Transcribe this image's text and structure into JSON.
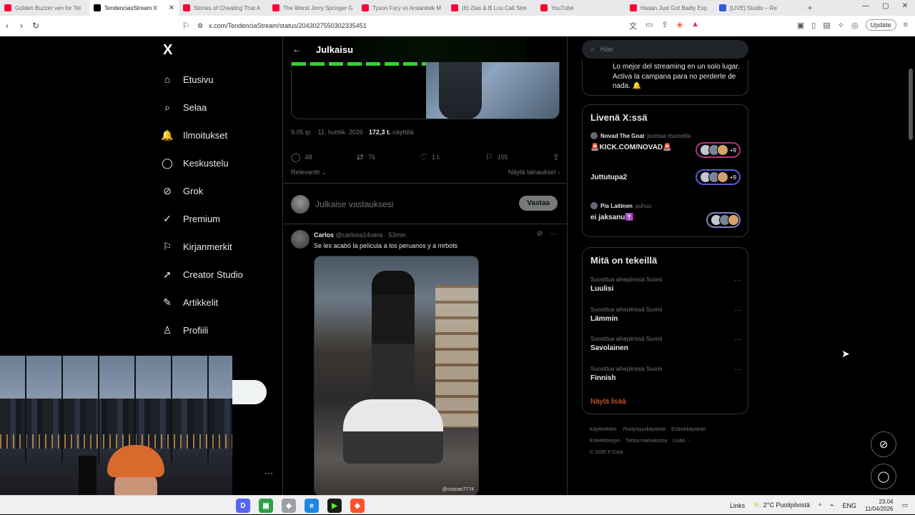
{
  "browser": {
    "tabs": [
      {
        "label": "Golden Buzzer ven for Tel",
        "color": "#ff0033"
      },
      {
        "label": "TendenciasStream X",
        "color": "#000000",
        "active": true
      },
      {
        "label": "Stories of Cheating That A",
        "color": "#ff0033"
      },
      {
        "label": "The Worst Jerry Springer G",
        "color": "#ff0033"
      },
      {
        "label": "Tyson Fury vs Arslanbek M",
        "color": "#ff0033"
      },
      {
        "label": "(6) Zias & B Lou Call Stre",
        "color": "#ff0033"
      },
      {
        "label": "YouTube",
        "color": "#ff0033"
      },
      {
        "label": "Hasan Just Got Badly Exp",
        "color": "#ff0033"
      },
      {
        "label": "[LIVE] Studio – Re",
        "color": "#2b5fd9"
      }
    ],
    "url": "x.com/TendenciaStream/status/2043027550302335451",
    "update_label": "Update"
  },
  "nav": {
    "logo": "X",
    "items": [
      {
        "label": "Etusivu",
        "icon": "home-icon",
        "glyph": "⌂"
      },
      {
        "label": "Selaa",
        "icon": "search-icon",
        "glyph": "⌕"
      },
      {
        "label": "Ilmoitukset",
        "icon": "bell-icon",
        "glyph": "🔔"
      },
      {
        "label": "Keskustelu",
        "icon": "chat-icon",
        "glyph": "◯"
      },
      {
        "label": "Grok",
        "icon": "grok-icon",
        "glyph": "⊘"
      },
      {
        "label": "Premium",
        "icon": "premium-icon",
        "glyph": "✓"
      },
      {
        "label": "Kirjanmerkit",
        "icon": "bookmark-icon",
        "glyph": "⚐"
      },
      {
        "label": "Creator Studio",
        "icon": "rocket-icon",
        "glyph": "➚"
      },
      {
        "label": "Artikkelit",
        "icon": "article-icon",
        "glyph": "✎"
      },
      {
        "label": "Profiili",
        "icon": "profile-icon",
        "glyph": "♙"
      }
    ]
  },
  "main": {
    "header_title": "Julkaisu",
    "post_time": "9.05 ip. · 11. huhtik. 2026 ·",
    "post_views": "172,3 t.",
    "post_views_label": "näyttöä",
    "stats": {
      "replies": "48",
      "reposts": "76",
      "likes": "1 t.",
      "bookmarks": "155"
    },
    "sort_label": "Relevantti",
    "quotes_link": "Näytä lainaukset",
    "reply_placeholder": "Julkaise vastauksesi",
    "reply_button": "Vastaa",
    "reply": {
      "name": "Carlos",
      "handle": "@carlosa14vera · 53min",
      "text": "Se les acabó la película a los peruanos y a mrbots",
      "watermark": "@coscas7774"
    }
  },
  "right": {
    "search_placeholder": "Hae",
    "promo_text": "Lo mejor del streaming en un solo lugar. Activa la campana para no perderte de nada. 🔔",
    "live_title": "Livenä X:ssä",
    "live": [
      {
        "host": "Novad The Goat",
        "action": "juontaa Huonetta",
        "title": "🚨KICK.COM/NOVAD🚨",
        "count": "+9"
      },
      {
        "host": "",
        "action": "",
        "title": "Juttutupa2",
        "count": "+9"
      },
      {
        "host": "Pia Laitinen",
        "action": "puhuu",
        "title": "ei jaksanu✝️",
        "count": ""
      }
    ],
    "trends_title": "Mitä on tekeillä",
    "trends": [
      {
        "category": "Suosittua aihepiirissä Suomi",
        "name": "Luulisi"
      },
      {
        "category": "Suosittua aihepiirissä Suomi",
        "name": "Lämmin"
      },
      {
        "category": "Suosittua aihepiirissä Suomi",
        "name": "Savolainen"
      },
      {
        "category": "Suosittua aihepiirissä Suomi",
        "name": "Finnish"
      }
    ],
    "show_more": "Näytä lisää",
    "footer": [
      "Käyttöehdot",
      "Yksityisyyskäytäntö",
      "Evästekäytäntö",
      "Esteettömyys",
      "Tietoa mainoksista",
      "Lisää ···",
      "© 2026 X Corp."
    ]
  },
  "taskbar": {
    "links": "Links",
    "weather": "2°C  Puolipilvistä",
    "lang": "ENG",
    "time": "23.04",
    "date": "11/04/2026"
  }
}
